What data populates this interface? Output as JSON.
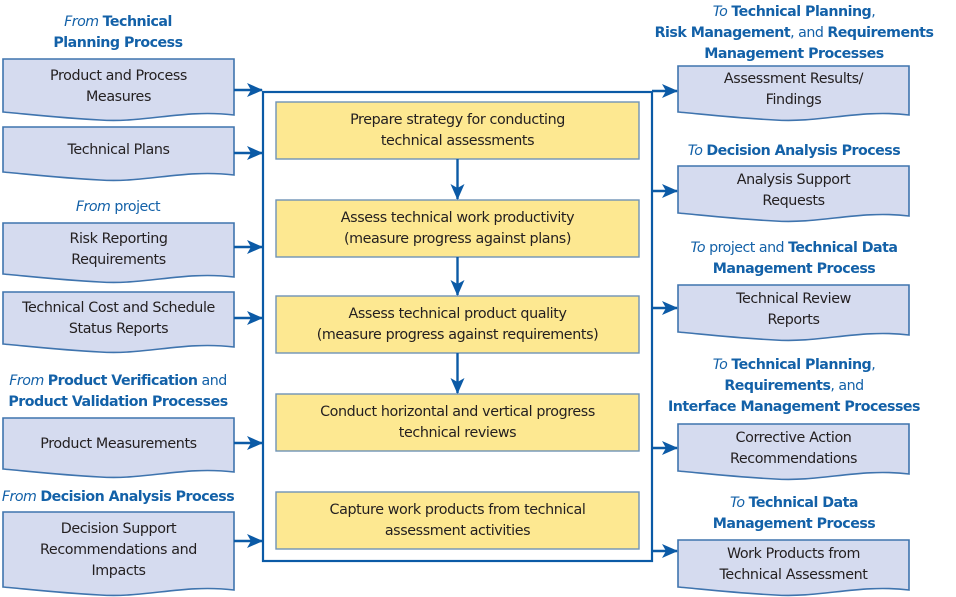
{
  "colors": {
    "line_blue": "#0b5aa6",
    "header_blue": "#1361a8",
    "doc_fill": "#d5dbef",
    "doc_border": "#3f74ae",
    "step_fill": "#fde891",
    "step_border": "#6f93b6",
    "text": "#231f20"
  },
  "inputs": [
    {
      "header": [
        {
          "text": "From ",
          "style": "italic"
        },
        {
          "text": "Technical",
          "style": "bold"
        },
        {
          "text": "\n",
          "style": "break"
        },
        {
          "text": "Planning Process",
          "style": "bold"
        }
      ],
      "documents": [
        {
          "label": "Product and Process\nMeasures"
        },
        {
          "label": "Technical Plans"
        }
      ]
    },
    {
      "header": [
        {
          "text": "From ",
          "style": "italic"
        },
        {
          "text": "project",
          "style": "normal"
        }
      ],
      "documents": [
        {
          "label": "Risk Reporting\nRequirements"
        },
        {
          "label": "Technical Cost and Schedule\nStatus Reports"
        }
      ]
    },
    {
      "header": [
        {
          "text": "From ",
          "style": "italic"
        },
        {
          "text": "Product Verification",
          "style": "bold"
        },
        {
          "text": " and",
          "style": "normal"
        },
        {
          "text": "\n",
          "style": "break"
        },
        {
          "text": "Product Validation Processes",
          "style": "bold"
        }
      ],
      "documents": [
        {
          "label": "Product Measurements"
        }
      ]
    },
    {
      "header": [
        {
          "text": "From ",
          "style": "italic"
        },
        {
          "text": "Decision Analysis Process",
          "style": "bold"
        }
      ],
      "documents": [
        {
          "label": "Decision Support\nRecommendations and\nImpacts"
        }
      ]
    }
  ],
  "process_steps": [
    {
      "label": "Prepare strategy for conducting\ntechnical assessments",
      "arrow_to_next": true
    },
    {
      "label": "Assess technical work productivity\n(measure progress against plans)",
      "arrow_to_next": true
    },
    {
      "label": "Assess technical product quality\n(measure progress against requirements)",
      "arrow_to_next": true
    },
    {
      "label": "Conduct horizontal and vertical progress\ntechnical reviews",
      "arrow_to_next": false
    },
    {
      "label": "Capture work products from technical\nassessment activities",
      "arrow_to_next": false
    }
  ],
  "outputs": [
    {
      "header": [
        {
          "text": "To ",
          "style": "italic"
        },
        {
          "text": "Technical Planning",
          "style": "bold"
        },
        {
          "text": ",",
          "style": "normal"
        },
        {
          "text": "\n",
          "style": "break"
        },
        {
          "text": "Risk Management",
          "style": "bold"
        },
        {
          "text": ", and ",
          "style": "normal"
        },
        {
          "text": "Requirements",
          "style": "bold"
        },
        {
          "text": "\n",
          "style": "break"
        },
        {
          "text": "Management Processes",
          "style": "bold"
        }
      ],
      "document": {
        "label": "Assessment Results/\nFindings"
      }
    },
    {
      "header": [
        {
          "text": "To ",
          "style": "italic"
        },
        {
          "text": "Decision Analysis Process",
          "style": "bold"
        }
      ],
      "document": {
        "label": "Analysis Support\nRequests"
      }
    },
    {
      "header": [
        {
          "text": "To ",
          "style": "italic"
        },
        {
          "text": "project and ",
          "style": "normal"
        },
        {
          "text": "Technical Data",
          "style": "bold"
        },
        {
          "text": "\n",
          "style": "break"
        },
        {
          "text": "Management Process",
          "style": "bold"
        }
      ],
      "document": {
        "label": "Technical Review\nReports"
      }
    },
    {
      "header": [
        {
          "text": "To ",
          "style": "italic"
        },
        {
          "text": "Technical Planning",
          "style": "bold"
        },
        {
          "text": ",",
          "style": "normal"
        },
        {
          "text": "\n",
          "style": "break"
        },
        {
          "text": "Requirements",
          "style": "bold"
        },
        {
          "text": ", and",
          "style": "normal"
        },
        {
          "text": "\n",
          "style": "break"
        },
        {
          "text": "Interface Management Processes",
          "style": "bold"
        }
      ],
      "document": {
        "label": "Corrective Action\nRecommendations"
      }
    },
    {
      "header": [
        {
          "text": "To ",
          "style": "italic"
        },
        {
          "text": "Technical Data",
          "style": "bold"
        },
        {
          "text": "\n",
          "style": "break"
        },
        {
          "text": "Management Process",
          "style": "bold"
        }
      ],
      "document": {
        "label": "Work Products from\nTechnical Assessment"
      }
    }
  ]
}
